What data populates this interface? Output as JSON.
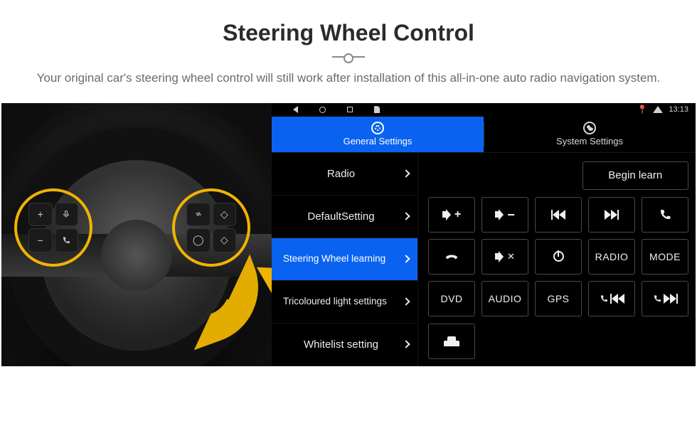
{
  "page": {
    "title": "Steering Wheel Control",
    "subtitle": "Your original car's steering wheel control will still work after installation of this all-in-one auto radio navigation system."
  },
  "status_bar": {
    "time": "13:13"
  },
  "tabs": {
    "general": "General Settings",
    "system": "System Settings"
  },
  "sidebar": {
    "items": [
      {
        "label": "Radio"
      },
      {
        "label": "DefaultSetting"
      },
      {
        "label": "Steering Wheel learning"
      },
      {
        "label": "Tricoloured light settings"
      },
      {
        "label": "Whitelist setting"
      }
    ]
  },
  "actions": {
    "begin": "Begin learn"
  },
  "grid": {
    "radio": "RADIO",
    "mode": "MODE",
    "dvd": "DVD",
    "audio": "AUDIO",
    "gps": "GPS"
  },
  "wheel_pads": {
    "left": [
      "+",
      "🎤",
      "−",
      "📞"
    ],
    "right": [
      "🔊",
      "◇",
      "◯",
      "◇"
    ]
  }
}
